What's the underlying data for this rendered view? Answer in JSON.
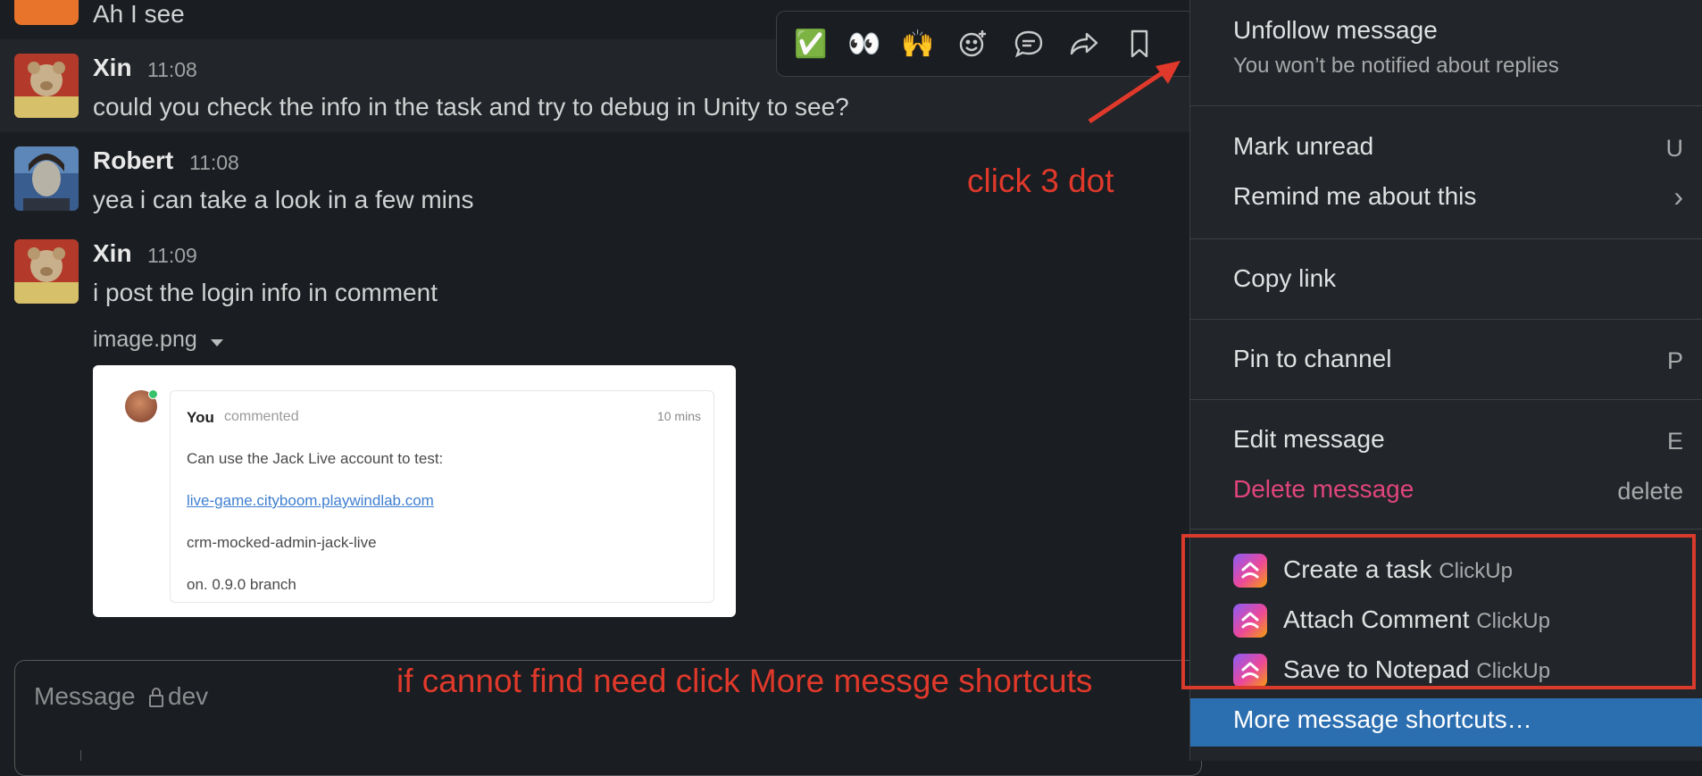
{
  "messages": [
    {
      "text": "Ah I see"
    },
    {
      "name": "Xin",
      "time": "11:08",
      "text": "could you check the info in the task and try to debug in Unity to see?"
    },
    {
      "name": "Robert",
      "time": "11:08",
      "text": "yea i can take a look in a few mins"
    },
    {
      "name": "Xin",
      "time": "11:09",
      "text": "i post the login info in comment"
    }
  ],
  "attachment": {
    "filename": "image.png",
    "preview": {
      "author": "You",
      "action": "commented",
      "age": "10 mins",
      "line1": "Can use the Jack Live account to test:",
      "link": "live-game.cityboom.playwindlab.com",
      "line3": "crm-mocked-admin-jack-live",
      "line4": "on. 0.9.0 branch"
    }
  },
  "toolbar": {
    "icons": [
      "check-reaction-icon",
      "eyes-reaction-icon",
      "raised-hands-reaction-icon",
      "add-reaction-icon",
      "reply-thread-icon",
      "forward-icon",
      "save-bookmark-icon"
    ],
    "emoji": {
      "check": "✅",
      "eyes": "👀",
      "hands": "🙌"
    }
  },
  "composer": {
    "placeholder": "Message",
    "channel": "dev"
  },
  "annotations": {
    "click_three_dot": "click 3 dot",
    "more_shortcuts": "if cannot find need click More messge shortcuts"
  },
  "menu": {
    "unfollow": "Unfollow message",
    "unfollow_sub": "You won’t be notified about replies",
    "mark_unread": "Mark unread",
    "mark_unread_key": "U",
    "remind": "Remind me about this",
    "remind_chevron": "›",
    "copy_link": "Copy link",
    "pin": "Pin to channel",
    "pin_key": "P",
    "edit": "Edit message",
    "edit_key": "E",
    "delete": "Delete message",
    "delete_key": "delete",
    "clickup_items": [
      {
        "label": "Create a task",
        "app": "ClickUp"
      },
      {
        "label": "Attach Comment",
        "app": "ClickUp"
      },
      {
        "label": "Save to Notepad",
        "app": "ClickUp"
      }
    ],
    "more_shortcuts": "More message shortcuts…"
  },
  "colors": {
    "background": "#1a1d21",
    "menu_bg": "#222529",
    "highlight": "#2c6fb1",
    "delete_red": "#e0457b",
    "annotation_red": "#e0392b"
  }
}
